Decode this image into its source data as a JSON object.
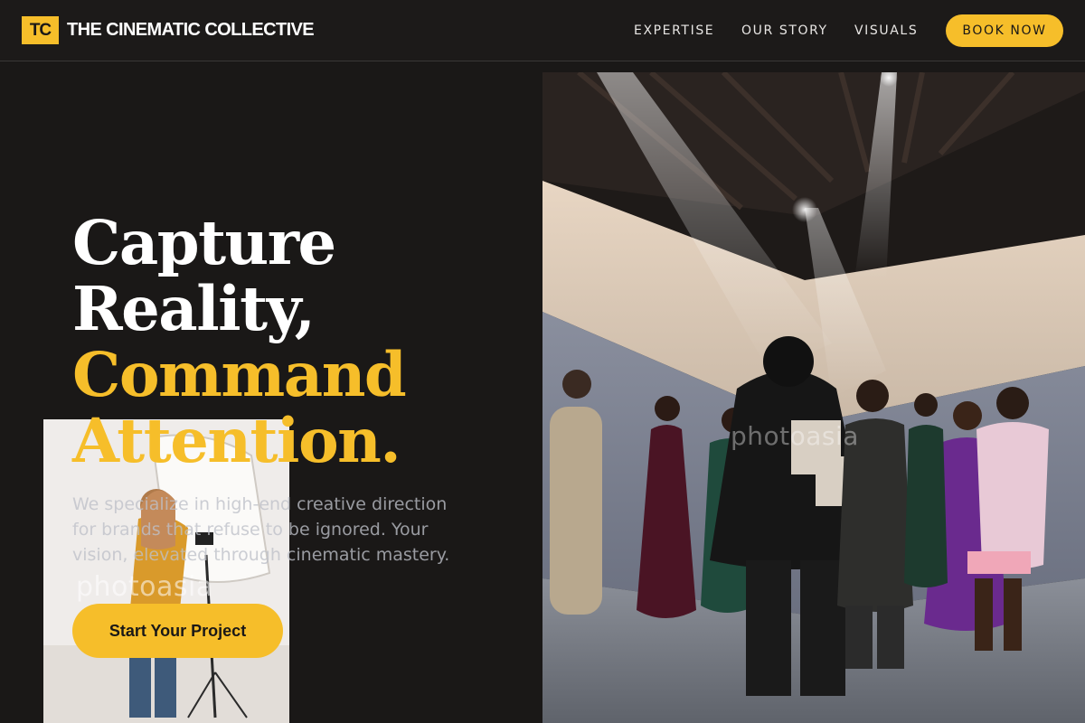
{
  "header": {
    "logo_mark": "TC",
    "brand_name": "THE CINEMATIC COLLECTIVE",
    "nav": [
      "EXPERTISE",
      "OUR STORY",
      "VISUALS"
    ],
    "book_label": "BOOK NOW"
  },
  "hero": {
    "headline": {
      "line1": "Capture",
      "line2": "Reality,",
      "line3": "Command",
      "line4": "Attention."
    },
    "subcopy": "We specialize in high-end creative direction for brands that refuse to be ignored. Your vision, elevated through cinematic mastery.",
    "cta_label": "Start Your Project"
  },
  "images": {
    "hero_watermark": "photoasia",
    "inset_watermark": "photoasia"
  },
  "colors": {
    "accent": "#f6be2a",
    "background": "#1a1817",
    "text": "#ffffff"
  }
}
